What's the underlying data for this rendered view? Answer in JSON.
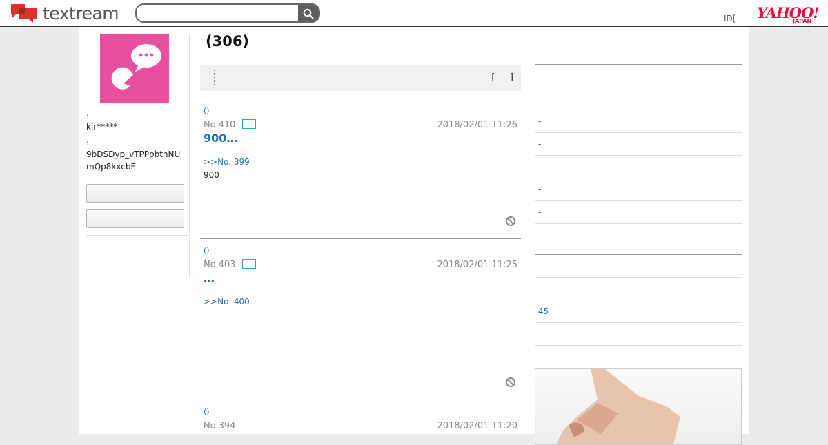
{
  "header": {
    "logo_text": "textream",
    "search": {
      "placeholder": "",
      "value": ""
    },
    "id_text": "ID[",
    "yahoo_logo": "YAHOO!",
    "yahoo_sub": "JAPAN"
  },
  "profile": {
    "label1": ":",
    "username": "kir*****",
    "label2": ":",
    "user_id_line1": "9bDSDyp_vTPPpbtnNU",
    "user_id_line2": "mQp8kxcbE-",
    "button1": "",
    "button2": ""
  },
  "main": {
    "title": "(306)",
    "toolbar_sort": "[    ]"
  },
  "posts": [
    {
      "author": "()",
      "number": "No.410",
      "date": "2018/02/01 11:26",
      "title": "900…",
      "reply": ">>No. 399",
      "body": "900"
    },
    {
      "author": "()",
      "number": "No.403",
      "date": "2018/02/01 11:25",
      "title": "…",
      "reply": ">>No. 400",
      "body": ""
    },
    {
      "author": "()",
      "number": "No.394",
      "date": "2018/02/01 11:20",
      "title": "",
      "reply": "",
      "body": ""
    }
  ],
  "sidebar": {
    "list1": [
      "-",
      "-",
      "-",
      "-",
      "-",
      "-",
      "-"
    ],
    "list2": [
      "",
      "",
      "45",
      ""
    ]
  },
  "colors": {
    "brand_red": "#d9332e",
    "link_blue": "#1a6fb8",
    "avatar_pink": "#e8509f",
    "yahoo_red": "#ff0033"
  }
}
